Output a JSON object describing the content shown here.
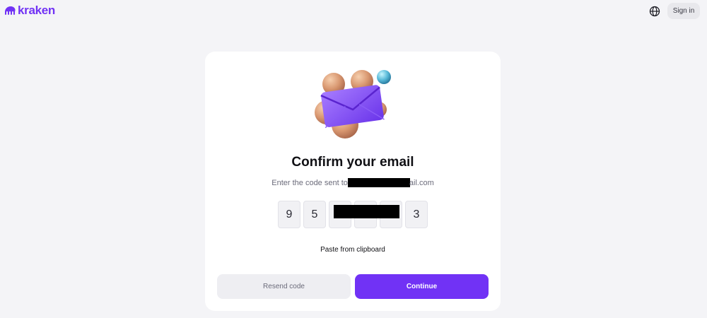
{
  "header": {
    "logo_text": "kraken",
    "logo_icon": "kraken-logo-icon",
    "language_icon": "globe-icon",
    "signin_label": "Sign in"
  },
  "card": {
    "illustration": "envelope-illustration",
    "title": "Confirm your email",
    "subtitle_prefix": "Enter the code sent to",
    "subtitle_suffix": "ail.com",
    "code_digits": [
      "9",
      "5",
      "",
      "",
      "",
      "3"
    ],
    "paste_label": "Paste from clipboard",
    "resend_label": "Resend code",
    "continue_label": "Continue"
  },
  "colors": {
    "brand": "#7132f5",
    "background": "#f4f4f7",
    "card": "#ffffff"
  }
}
